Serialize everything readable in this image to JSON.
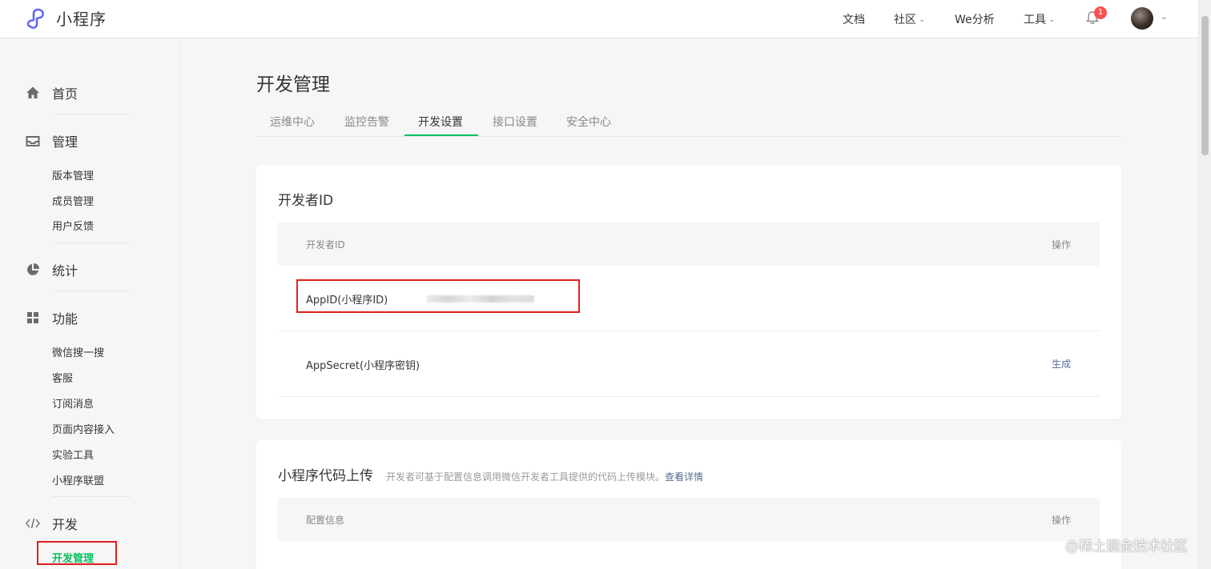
{
  "header": {
    "logo_text": "小程序",
    "nav": {
      "docs": "文档",
      "community": "社区",
      "analytics": "We分析",
      "tools": "工具"
    },
    "notification_count": "1"
  },
  "sidebar": {
    "home": "首页",
    "manage": "管理",
    "manage_items": [
      "版本管理",
      "成员管理",
      "用户反馈"
    ],
    "stats": "统计",
    "features": "功能",
    "feature_items": [
      "微信搜一搜",
      "客服",
      "订阅消息",
      "页面内容接入",
      "实验工具",
      "小程序联盟"
    ],
    "develop": "开发",
    "develop_items": [
      "开发管理"
    ]
  },
  "main": {
    "title": "开发管理",
    "tabs": [
      "运维中心",
      "监控告警",
      "开发设置",
      "接口设置",
      "安全中心"
    ],
    "active_tab": "开发设置",
    "developer_id": {
      "title": "开发者ID",
      "col_id": "开发者ID",
      "col_action": "操作",
      "rows": [
        {
          "label": "AppID(小程序ID)",
          "action": ""
        },
        {
          "label": "AppSecret(小程序密钥)",
          "action": "生成"
        }
      ]
    },
    "code_upload": {
      "title": "小程序代码上传",
      "desc": "开发者可基于配置信息调用微信开发者工具提供的代码上传模块。",
      "desc_link": "查看详情",
      "col_config": "配置信息",
      "col_action": "操作"
    }
  },
  "watermark": "@稀土掘金技术社区",
  "colors": {
    "accent": "#07c160",
    "link": "#576b95",
    "highlight": "#e02020",
    "badge": "#fa5151"
  }
}
